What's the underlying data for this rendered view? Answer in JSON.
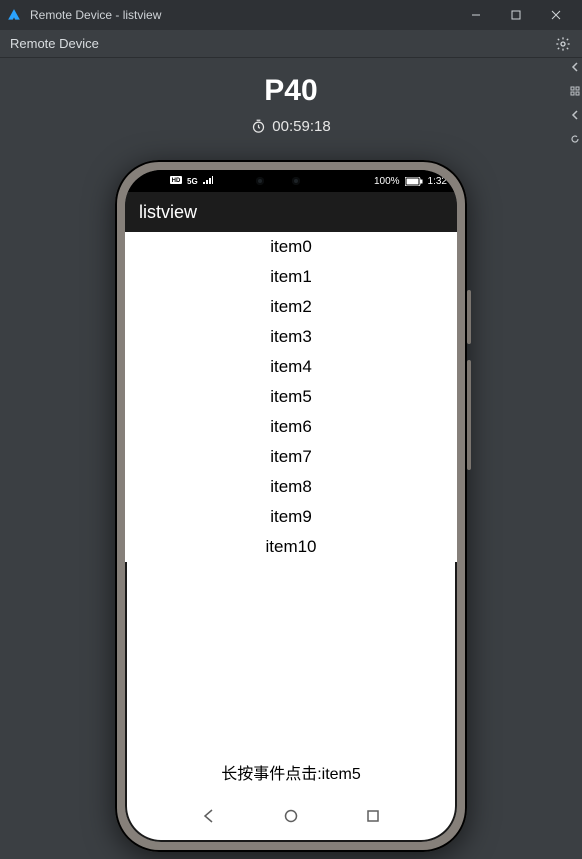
{
  "window": {
    "title": "Remote Device - listview",
    "subtitle": "Remote Device"
  },
  "device": {
    "name": "P40",
    "timer": "00:59:18"
  },
  "status_bar": {
    "battery_text": "100%",
    "time": "1:32"
  },
  "app": {
    "title": "listview"
  },
  "list": {
    "items": [
      {
        "label": "item0"
      },
      {
        "label": "item1"
      },
      {
        "label": "item2"
      },
      {
        "label": "item3"
      },
      {
        "label": "item4"
      },
      {
        "label": "item5"
      },
      {
        "label": "item6"
      },
      {
        "label": "item7"
      },
      {
        "label": "item8"
      },
      {
        "label": "item9"
      },
      {
        "label": "item10"
      }
    ]
  },
  "toast": {
    "text": "长按事件点击:item5"
  }
}
